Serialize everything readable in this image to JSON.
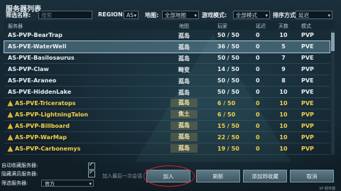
{
  "window": {
    "title": "服务器列表"
  },
  "filters": {
    "name_label": "筛选名称:",
    "search_placeholder": "搜索",
    "region_label": "REGION:",
    "region_value": "AS",
    "map_label": "地图:",
    "map_value": "全部地图",
    "mode_label": "游戏模式:",
    "mode_value": "全部模式",
    "sort_label": "排序方式:",
    "sort_value": "延迟"
  },
  "columns": {
    "server": "服务器",
    "map": "地图",
    "players": "玩家",
    "ping": "延迟",
    "days": "天数",
    "mode": "模式"
  },
  "rows": [
    {
      "name": "AS-PVP-BearTrap",
      "map": "孤岛",
      "players": "50 / 50",
      "ping": "0",
      "days": "10",
      "mode": "PVP"
    },
    {
      "name": "AS-PVE-WaterWell",
      "map": "孤岛",
      "players": "36 / 50",
      "ping": "0",
      "days": "5",
      "mode": "PVE"
    },
    {
      "name": "AS-PVE-Basilosaurus",
      "map": "孤岛",
      "players": "50 / 50",
      "ping": "0",
      "days": "7",
      "mode": "PVE"
    },
    {
      "name": "AS-PVP-Claw",
      "map": "畸变",
      "players": "14 / 50",
      "ping": "0",
      "days": "9",
      "mode": "PVP"
    },
    {
      "name": "AS-PVE-Araneo",
      "map": "孤岛",
      "players": "50 / 50",
      "ping": "0",
      "days": "8",
      "mode": "PVE"
    },
    {
      "name": "AS-PVE-HiddenLake",
      "map": "孤岛",
      "players": "50 / 50",
      "ping": "0",
      "days": "10",
      "mode": "PVE"
    },
    {
      "name": "AS-PVE-Triceratops",
      "map": "孤岛",
      "players": "6 / 50",
      "ping": "0",
      "days": "10",
      "mode": "PVE"
    },
    {
      "name": "AS-PVP-LightningTalon",
      "map": "焦土",
      "players": "6 / 50",
      "ping": "0",
      "days": "10",
      "mode": "PVP"
    },
    {
      "name": "AS-PVP-Billboard",
      "map": "孤岛",
      "players": "15 / 50",
      "ping": "0",
      "days": "10",
      "mode": "PVP"
    },
    {
      "name": "AS-PVP-WarMap",
      "map": "孤岛",
      "players": "22 / 50",
      "ping": "0",
      "days": "10",
      "mode": "PVP"
    },
    {
      "name": "AS-PVP-Carbonemys",
      "map": "孤岛",
      "players": "19 / 50",
      "ping": "0",
      "days": "10",
      "mode": "PVP"
    }
  ],
  "bottom": {
    "auto_favorite_label": "自动收藏服务器:",
    "hide_full_label": "隐藏满员服务器:",
    "filter_servers_label": "筛选服务器:",
    "filter_servers_value": "官方",
    "join_last_hint": "加入最后一次会话",
    "join_button": "加入",
    "refresh_button": "刷新",
    "add_favorite_button": "添加到收藏",
    "cancel_button": "取消",
    "version": "SP 服务器"
  },
  "colors": {
    "selected_row": "#8cbed2",
    "favorite_text": "#f2d04a",
    "highlight_circle": "#d8202a"
  }
}
